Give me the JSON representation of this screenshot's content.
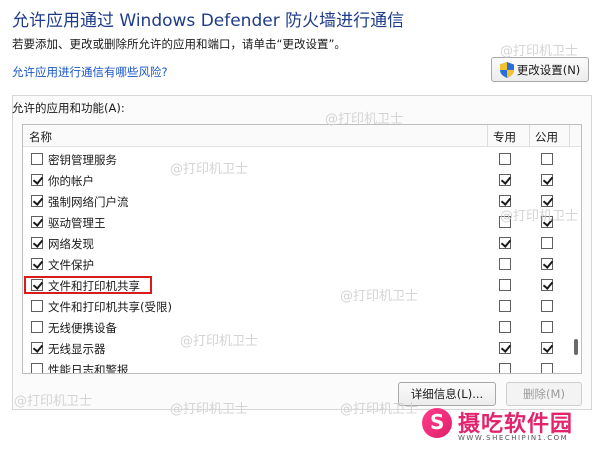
{
  "header": {
    "title": "允许应用通过 Windows Defender 防火墙进行通信",
    "subtitle": "若要添加、更改或删除所允许的应用和端口，请单击“更改设置”。",
    "risk_link": "允许应用进行通信有哪些风险?",
    "change_settings": "更改设置(N)"
  },
  "group": {
    "label": "允许的应用和功能(A):"
  },
  "table": {
    "columns": {
      "name": "名称",
      "private": "专用",
      "public": "公用"
    },
    "rows": [
      {
        "name": "密钥管理服务",
        "enabled": false,
        "private": false,
        "public": false
      },
      {
        "name": "你的帐户",
        "enabled": true,
        "private": true,
        "public": true
      },
      {
        "name": "强制网络门户流",
        "enabled": true,
        "private": true,
        "public": true
      },
      {
        "name": "驱动管理王",
        "enabled": true,
        "private": false,
        "public": true
      },
      {
        "name": "网络发现",
        "enabled": true,
        "private": true,
        "public": false
      },
      {
        "name": "文件保护",
        "enabled": true,
        "private": false,
        "public": true
      },
      {
        "name": "文件和打印机共享",
        "enabled": true,
        "private": false,
        "public": true,
        "highlighted": true
      },
      {
        "name": "文件和打印机共享(受限)",
        "enabled": false,
        "private": false,
        "public": false
      },
      {
        "name": "无线便携设备",
        "enabled": false,
        "private": false,
        "public": false
      },
      {
        "name": "无线显示器",
        "enabled": true,
        "private": true,
        "public": true
      },
      {
        "name": "性能日志和警报",
        "enabled": false,
        "private": false,
        "public": false
      }
    ]
  },
  "buttons": {
    "details": "详细信息(L)...",
    "delete": "删除(M)"
  },
  "watermark": "@打印机卫士",
  "logo": {
    "name": "摄吃软件园",
    "url": "WWW.SHECHIPIN1.COM"
  },
  "colors": {
    "title": "#1f3c8a",
    "link": "#1a56c8",
    "highlight": "#d81c1c",
    "logo": "#e2246e"
  }
}
